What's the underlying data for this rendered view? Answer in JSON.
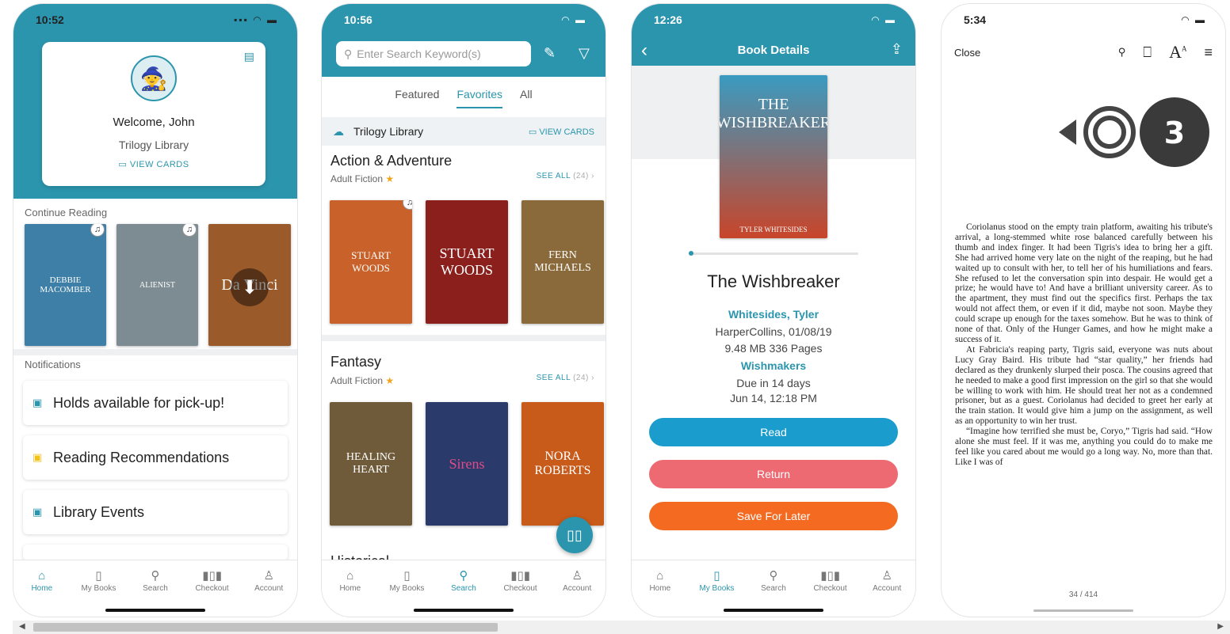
{
  "colors": {
    "teal": "#2b95ad",
    "read": "#1a9ccc",
    "return": "#ee6a72",
    "save": "#f56a21",
    "star": "#f2a51a"
  },
  "tabs": [
    {
      "label": "Home",
      "icon": "home-icon"
    },
    {
      "label": "My Books",
      "icon": "book-icon"
    },
    {
      "label": "Search",
      "icon": "search-icon"
    },
    {
      "label": "Checkout",
      "icon": "barcode-icon"
    },
    {
      "label": "Account",
      "icon": "person-icon"
    }
  ],
  "home": {
    "time": "10:52",
    "welcome": "Welcome, John",
    "library": "Trilogy Library",
    "view_cards": "VIEW CARDS",
    "continue_reading": "Continue Reading",
    "books": [
      {
        "title": "DEBBIE MACOMBER",
        "color": "#3d7fa6"
      },
      {
        "title": "ALIENIST",
        "color": "#7d8c92"
      },
      {
        "title": "Da Vinci",
        "color": "#9a5a2a"
      }
    ],
    "notifications_label": "Notifications",
    "notifications": [
      {
        "label": "Holds available for pick-up!",
        "icon": "calendar-icon"
      },
      {
        "label": "Reading Recommendations",
        "icon": "bookmark-icon"
      },
      {
        "label": "Library Events",
        "icon": "event-icon"
      }
    ]
  },
  "search": {
    "time": "10:56",
    "placeholder": "Enter Search Keyword(s)",
    "segments": [
      "Featured",
      "Favorites",
      "All"
    ],
    "active_segment": "Favorites",
    "library": "Trilogy Library",
    "view_cards": "VIEW CARDS",
    "categories": [
      {
        "title": "Action & Adventure",
        "subtitle": "Adult Fiction",
        "see_all": "SEE ALL",
        "count": "(24)",
        "books": [
          {
            "title": "STUART WOODS",
            "color": "#c8622a"
          },
          {
            "title": "STUART WOODS",
            "color": "#8a1f1c"
          },
          {
            "title": "FERN MICHAELS",
            "color": "#8a6a3a"
          }
        ]
      },
      {
        "title": "Fantasy",
        "subtitle": "Adult Fiction",
        "see_all": "SEE ALL",
        "count": "(24)",
        "books": [
          {
            "title": "HEALING HEART",
            "color": "#6f5a3a"
          },
          {
            "title": "Sirens",
            "color": "#2a3a6a"
          },
          {
            "title": "NORA ROBERTS",
            "color": "#c85a1a"
          }
        ]
      }
    ],
    "partial_heading": "Historical"
  },
  "details": {
    "time": "12:26",
    "header": "Book Details",
    "cover_title": "THE WISHBREAKER",
    "cover_author": "TYLER WHITESIDES",
    "title": "The Wishbreaker",
    "author": "Whitesides, Tyler",
    "publisher": "HarperCollins, 01/08/19",
    "size": "9.48 MB 336 Pages",
    "series": "Wishmakers",
    "due": "Due in 14 days",
    "due_date": "Jun 14, 12:18 PM",
    "read": "Read",
    "return": "Return",
    "save": "Save For Later"
  },
  "reader": {
    "time": "5:34",
    "close": "Close",
    "logo_text": "3",
    "paragraphs": [
      "Coriolanus stood on the empty train platform, awaiting his tribute's arrival, a long-stemmed white rose balanced carefully between his thumb and index finger. It had been Tigris's idea to bring her a gift. She had arrived home very late on the night of the reaping, but he had waited up to consult with her, to tell her of his humiliations and fears. She refused to let the conversation spin into despair. He would get a prize; he would have to! And have a brilliant university career. As to the apartment, they must find out the specifics first. Perhaps the tax would not affect them, or even if it did, maybe not soon. Maybe they could scrape up enough for the taxes somehow. But he was to think of none of that. Only of the Hunger Games, and how he might make a success of it.",
      "At Fabricia's reaping party, Tigris said, everyone was nuts about Lucy Gray Baird. His tribute had “star quality,” her friends had declared as they drunkenly slurped their posca. The cousins agreed that he needed to make a good first impression on the girl so that she would be willing to work with him. He should treat her not as a condemned prisoner, but as a guest. Coriolanus had decided to greet her early at the train station. It would give him a jump on the assignment, as well as an opportunity to win her trust.",
      "“Imagine how terrified she must be, Coryo,” Tigris had said. “How alone she must feel. If it was me, anything you could do to make me feel like you cared about me would go a long way. No, more than that. Like I was of"
    ],
    "page": "34 / 414"
  }
}
